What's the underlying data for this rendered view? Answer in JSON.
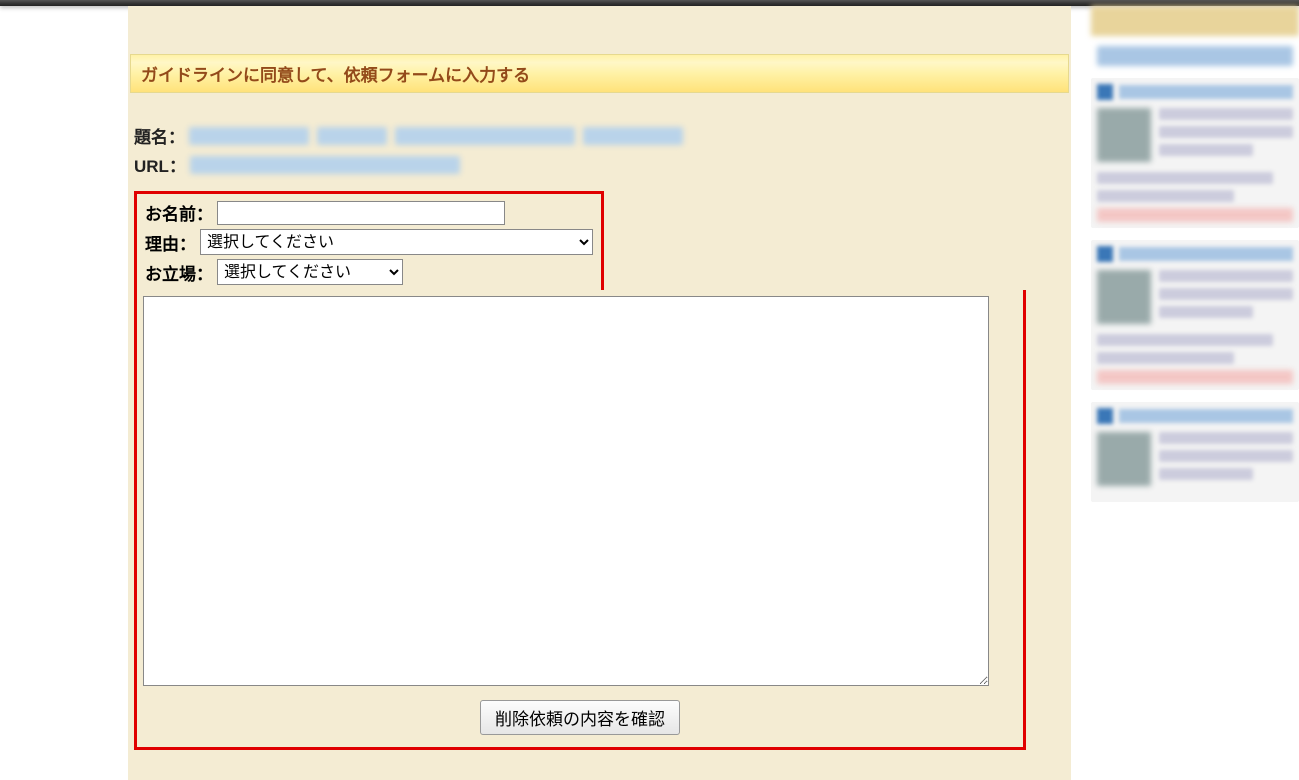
{
  "banner": {
    "text": "ガイドラインに同意して、依頼フォームに入力する"
  },
  "meta": {
    "title_label": "題名：",
    "url_label": "URL："
  },
  "form": {
    "name_label": "お名前：",
    "reason_label": "理由：",
    "position_label": "お立場：",
    "select_placeholder": "選択してください",
    "submit_label": "削除依頼の内容を確認"
  }
}
